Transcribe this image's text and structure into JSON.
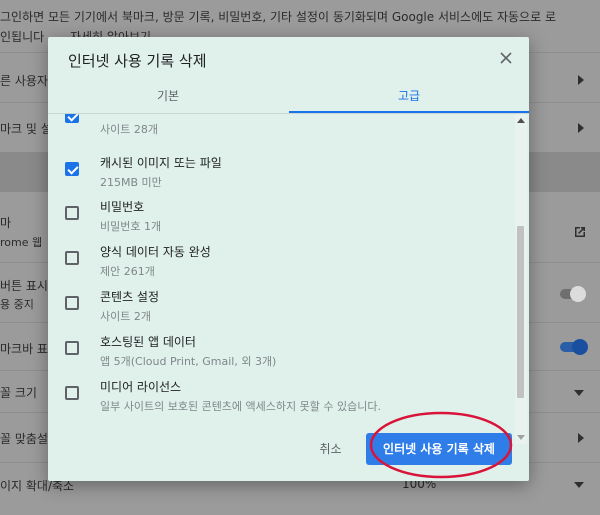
{
  "background": {
    "sync_notice": "그인하면 모든 기기에서 북마크, 방문 기록, 비밀번호, 기타 설정이 동기화되며 Google 서비스에도 자동으로 로",
    "sync_notice_2": "인됩니다",
    "learn_more": "자세히 알아보기",
    "row_other_users": "른 사용자",
    "row_bookmarks": "마크 및 설",
    "row_theme": "마",
    "row_theme_sub": "rome 웹",
    "row_home_button": "버튼 표시",
    "row_home_sub": "용 중지",
    "row_bookmark_bar": "마크바 표",
    "row_font_size": "꼴 크기",
    "row_custom_fonts": "꼴 맞춤설",
    "row_zoom": "이지 확대/축소",
    "zoom_value": "100%"
  },
  "dialog": {
    "title": "인터넷 사용 기록 삭제",
    "tabs": [
      {
        "label": "기본",
        "active": false
      },
      {
        "label": "고급",
        "active": true
      }
    ],
    "items": [
      {
        "title": "",
        "sub": "사이트 28개",
        "checked": true
      },
      {
        "title": "캐시된 이미지 또는 파일",
        "sub": "215MB 미만",
        "checked": true
      },
      {
        "title": "비밀번호",
        "sub": "비밀번호 1개",
        "checked": false
      },
      {
        "title": "양식 데이터 자동 완성",
        "sub": "제안 261개",
        "checked": false
      },
      {
        "title": "콘텐츠 설정",
        "sub": "사이트 2개",
        "checked": false
      },
      {
        "title": "호스팅된 앱 데이터",
        "sub": "앱 5개(Cloud Print, Gmail, 외 3개)",
        "checked": false
      },
      {
        "title": "미디어 라이선스",
        "sub": "일부 사이트의 보호된 콘텐츠에 액세스하지 못할 수 있습니다.",
        "checked": false
      }
    ],
    "cancel_label": "취소",
    "delete_label": "인터넷 사용 기록 삭제"
  },
  "colors": {
    "accent": "#1a73e8",
    "dialog_bg": "#dff1ea",
    "annotation": "#d9143a"
  }
}
